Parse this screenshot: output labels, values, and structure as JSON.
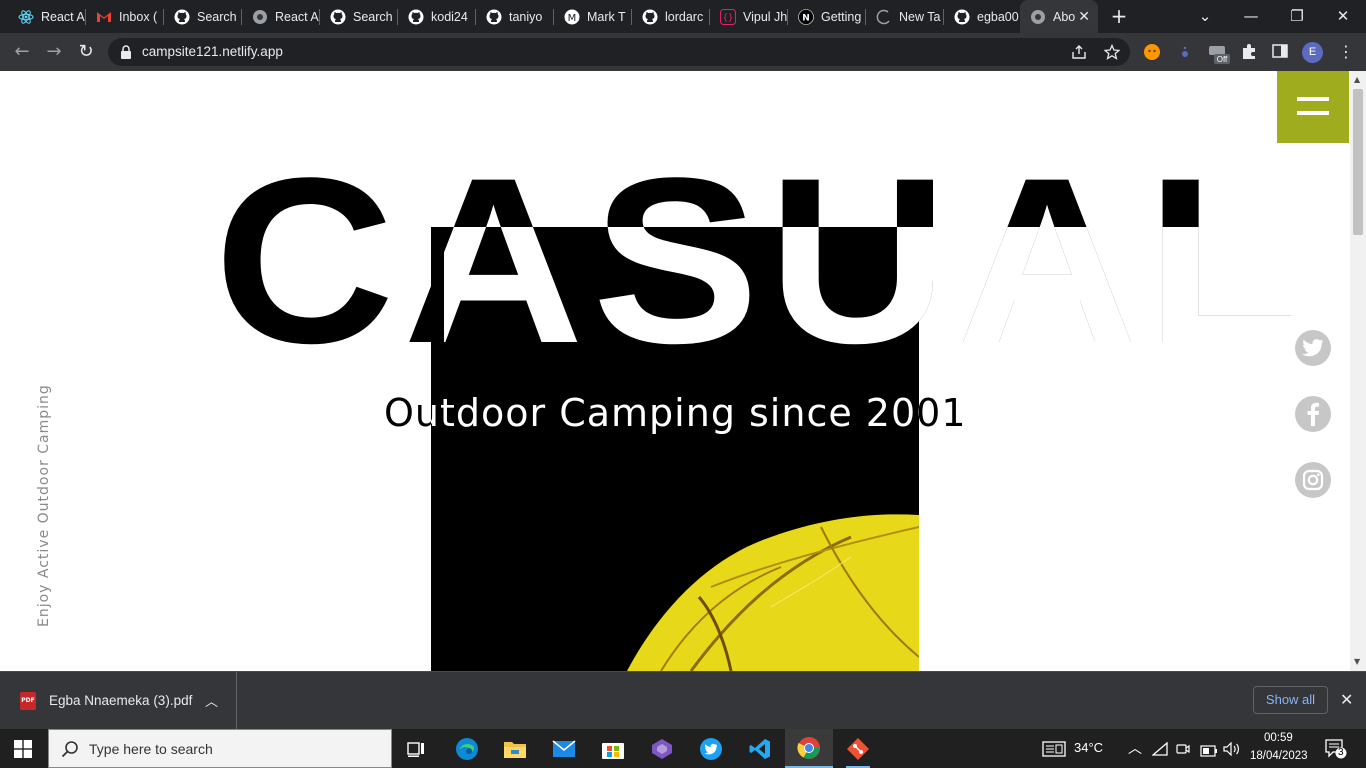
{
  "browser": {
    "tabs": [
      {
        "label": "React A",
        "icon": "react-icon"
      },
      {
        "label": "Inbox (",
        "icon": "gmail-icon"
      },
      {
        "label": "Search",
        "icon": "github-icon"
      },
      {
        "label": "React A",
        "icon": "globe-icon"
      },
      {
        "label": "Search",
        "icon": "github-icon"
      },
      {
        "label": "kodi24",
        "icon": "github-icon"
      },
      {
        "label": "taniyo",
        "icon": "github-icon"
      },
      {
        "label": "Mark T",
        "icon": "medium-icon"
      },
      {
        "label": "lordarc",
        "icon": "github-icon"
      },
      {
        "label": "Vipul Jh",
        "icon": "code-icon"
      },
      {
        "label": "Getting",
        "icon": "nextjs-icon"
      },
      {
        "label": "New Ta",
        "icon": "loading-icon"
      },
      {
        "label": "egba00",
        "icon": "github-icon"
      },
      {
        "label": "Abo",
        "icon": "globe-icon"
      }
    ],
    "new_tab": "+",
    "url": "campsite121.netlify.app",
    "profile_initial": "E",
    "extension_badge": "Off"
  },
  "page": {
    "hero_title": "CASUAL",
    "subtitle": "Outdoor Camping since 2001",
    "vertical_tagline": "Enjoy Active Outdoor Camping",
    "accent_color": "#9eac1d",
    "social": [
      "twitter-icon",
      "facebook-icon",
      "instagram-icon"
    ]
  },
  "downloads": {
    "file_name": "Egba Nnaemeka  (3).pdf",
    "file_type": "PDF",
    "show_all": "Show all"
  },
  "taskbar": {
    "search_placeholder": "Type here to search",
    "temperature": "34°C",
    "time": "00:59",
    "date": "18/04/2023",
    "notification_count": "3"
  }
}
